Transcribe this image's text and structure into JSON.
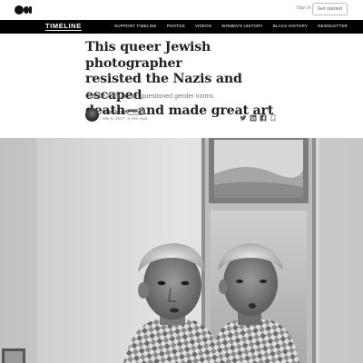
{
  "topbar": {
    "logo_icon": "medium-logo-icon",
    "signin_label": "Sign in",
    "get_started_label": "Get started"
  },
  "nav": {
    "brand": "TIMELINE",
    "links": [
      "SUPPORT TIMELINE",
      "PHOTOS",
      "VIDEOS",
      "WOMEN'S HISTORY",
      "BLACK HISTORY",
      "NEWSLETTER"
    ]
  },
  "article": {
    "headline_lines": [
      "This queer Jewish photographer",
      "resisted the Nazis and escaped",
      "death—and made great art"
    ],
    "subhead": "Claude Cahun’s art questioned gender norms",
    "author": "Rian Dundon",
    "follow_label": "Follow",
    "date": "Mar 8, 2017",
    "read_time": "4 min read"
  },
  "share_icons": [
    "twitter-icon",
    "linkedin-icon",
    "facebook-icon",
    "bookmark-icon"
  ],
  "photo": {
    "subject": "black-and-white self-portrait with mirror"
  }
}
